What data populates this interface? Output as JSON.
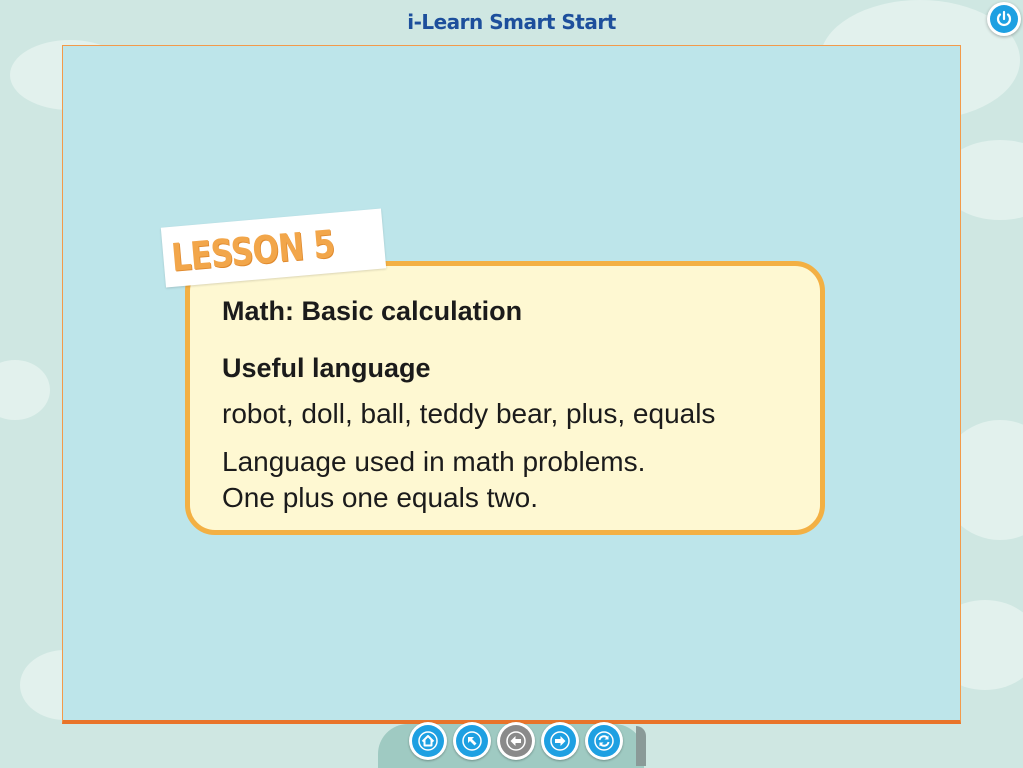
{
  "app": {
    "title": "i-Learn Smart Start"
  },
  "lesson": {
    "badge": "LESSON 5",
    "subject": "Math: Basic calculation",
    "heading": "Useful language",
    "vocabulary": "robot, doll, ball, teddy bear, plus, equals",
    "language_line_1": "Language used in math problems.",
    "language_line_2": "One plus one equals two."
  },
  "navigation": {
    "buttons": [
      {
        "icon": "home-icon",
        "enabled": true
      },
      {
        "icon": "arrow-up-left-icon",
        "enabled": true
      },
      {
        "icon": "arrow-left-icon",
        "enabled": false
      },
      {
        "icon": "arrow-right-icon",
        "enabled": true
      },
      {
        "icon": "refresh-icon",
        "enabled": true
      }
    ]
  },
  "colors": {
    "title": "#1d4f9c",
    "stage_bg": "#bde5ea",
    "card_bg": "#fef8d2",
    "card_border": "#f3b043",
    "badge_text": "#f2a64a",
    "button_active": "#1ea0e2",
    "button_disabled": "#8a8a8a"
  }
}
